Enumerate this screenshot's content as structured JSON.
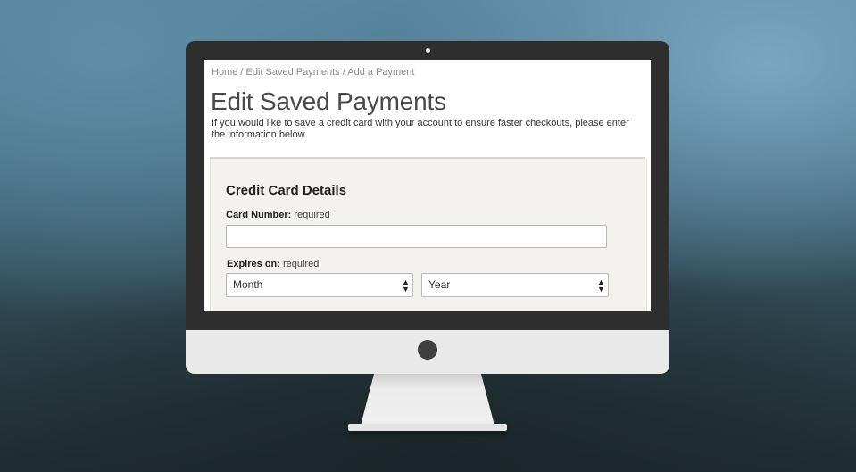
{
  "breadcrumb": {
    "home": "Home",
    "separator": " / ",
    "edit_saved_payments": "Edit Saved Payments",
    "current": "Add a Payment"
  },
  "page": {
    "title": "Edit Saved Payments",
    "intro": "If you would like to save a credit card with your account to ensure faster checkouts, please enter the information below."
  },
  "form": {
    "heading": "Credit Card Details",
    "card_number": {
      "label": "Card Number:",
      "required": "required",
      "value": ""
    },
    "expires": {
      "label": "Expires on:",
      "required": "required",
      "month": {
        "value": "Month"
      },
      "year": {
        "value": "Year"
      }
    }
  },
  "colors": {
    "bezel": "#2e2e2e",
    "chin": "#e9e9e9",
    "panel_background": "#f3f2ee",
    "title_text": "#4a4a4a"
  },
  "icons": {
    "select_arrows": "up-down-arrows-icon"
  }
}
